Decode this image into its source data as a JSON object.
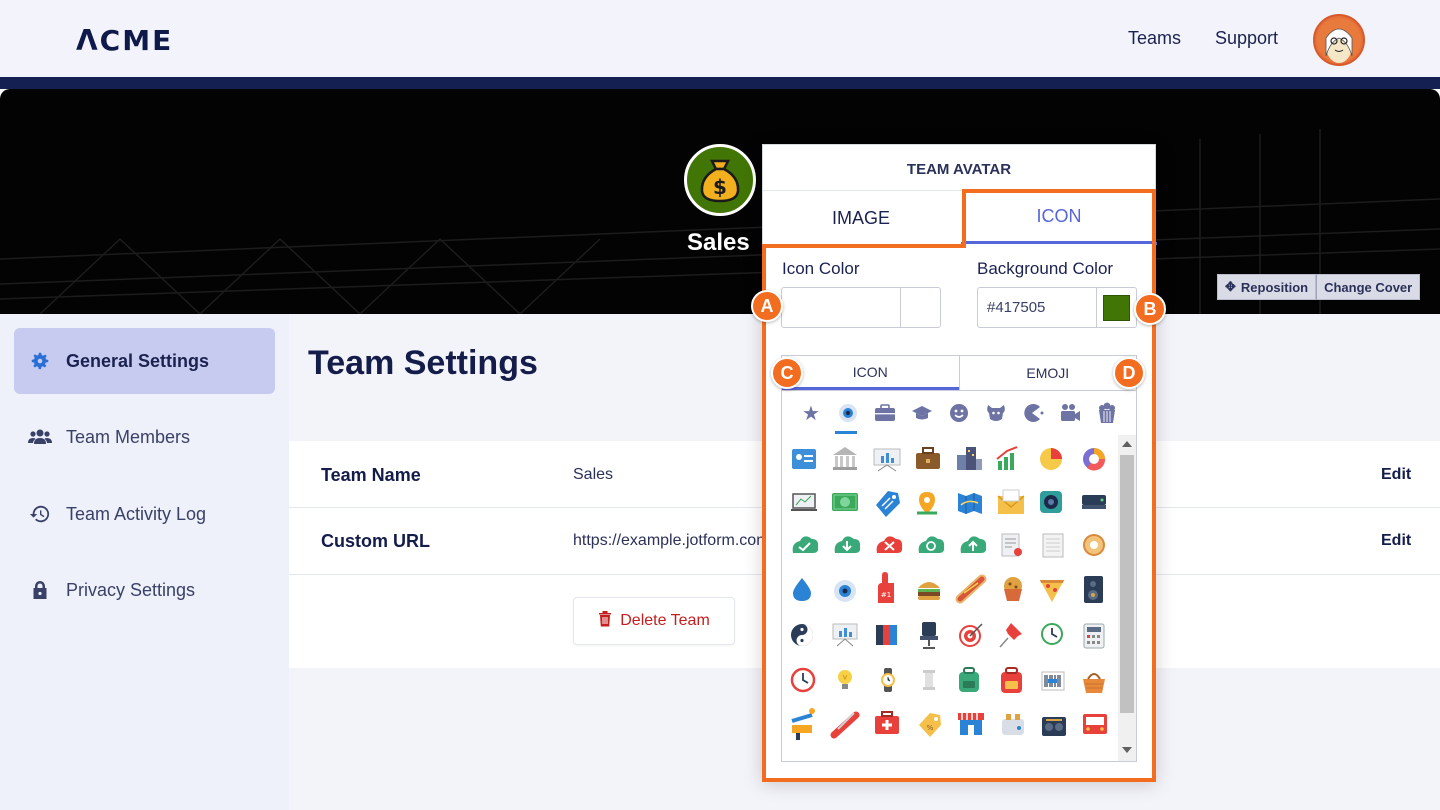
{
  "header": {
    "logo": "ΛCME",
    "nav": [
      "Teams",
      "Support"
    ]
  },
  "cover": {
    "team_name": "Sales",
    "buttons": [
      "Reposition",
      "Change Cover"
    ]
  },
  "sidebar": {
    "items": [
      {
        "label": "General Settings",
        "icon": "gear-icon",
        "active": true
      },
      {
        "label": "Team Members",
        "icon": "users-icon",
        "active": false
      },
      {
        "label": "Team Activity Log",
        "icon": "history-icon",
        "active": false
      },
      {
        "label": "Privacy Settings",
        "icon": "lock-icon",
        "active": false
      }
    ]
  },
  "main": {
    "title": "Team Settings",
    "fields": [
      {
        "label": "Team Name",
        "value": "Sales",
        "action": "Edit"
      },
      {
        "label": "Custom URL",
        "value": "https://example.jotform.com/sales",
        "action": "Edit"
      }
    ],
    "delete_label": "Delete Team"
  },
  "popover": {
    "title": "TEAM AVATAR",
    "tabs": [
      "IMAGE",
      "ICON"
    ],
    "active_tab": "ICON",
    "icon_color_label": "Icon Color",
    "icon_color_value": "",
    "bg_color_label": "Background Color",
    "bg_color_value": "#417505",
    "sub_tabs": [
      "ICON",
      "EMOJI"
    ],
    "categories": [
      "star-icon",
      "eye-icon",
      "briefcase-icon",
      "graduation-cap-icon",
      "smiley-icon",
      "dog-icon",
      "pacman-icon",
      "video-camera-icon",
      "popcorn-icon"
    ],
    "active_category": "eye-icon"
  },
  "callouts": [
    "A",
    "B",
    "C",
    "D"
  ],
  "colors": {
    "accent": "#5566d9",
    "highlight": "#f26d1f",
    "avatar_bg": "#417505",
    "sidebar_active": "#c7cbf0",
    "navy": "#141f52",
    "delete": "#c41e1e"
  }
}
